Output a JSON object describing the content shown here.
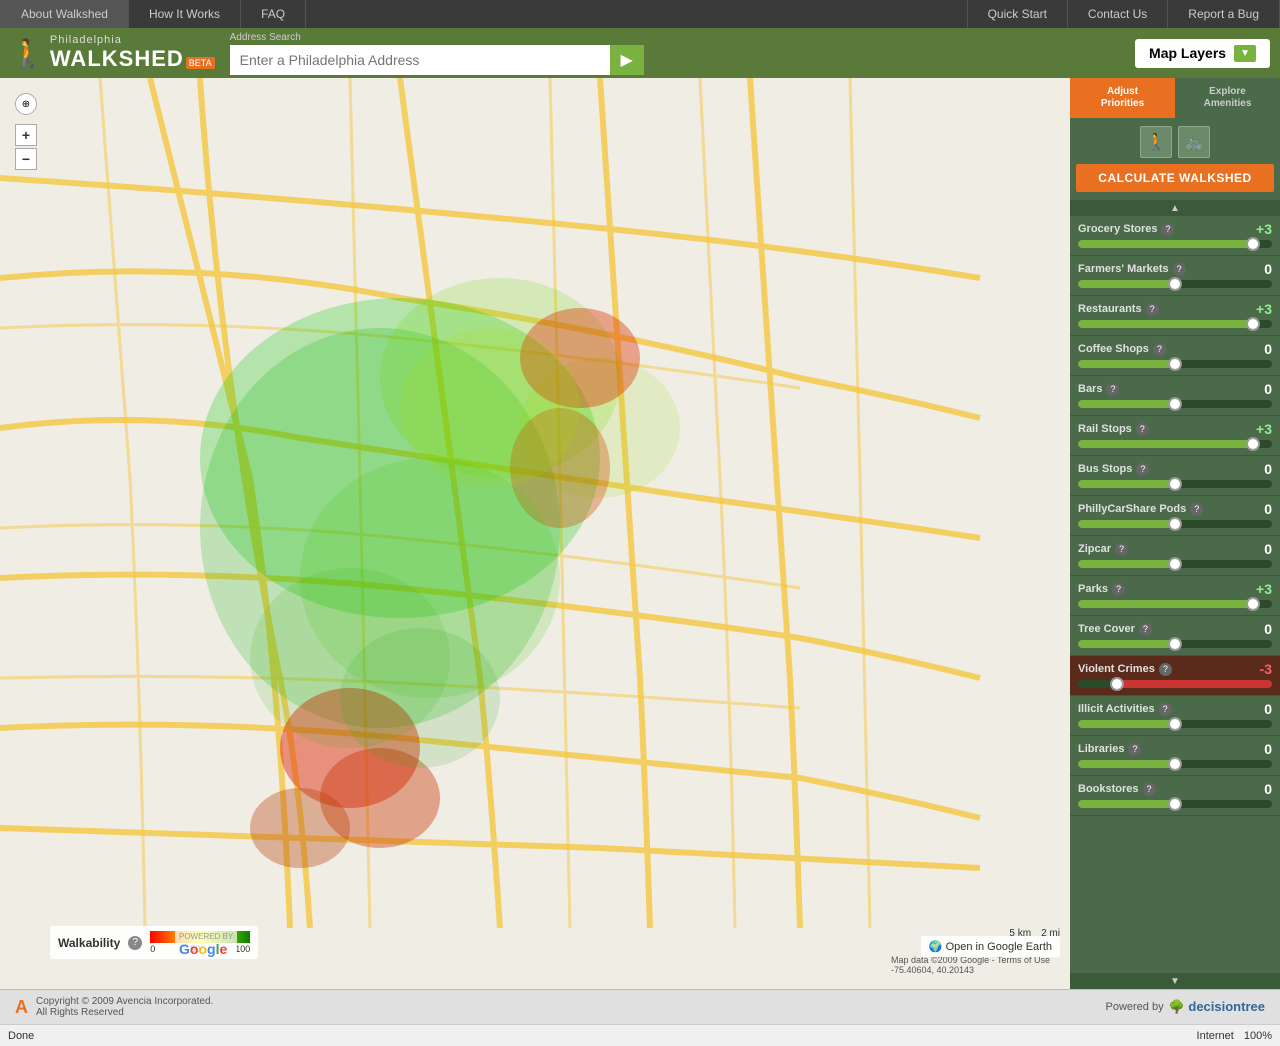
{
  "nav": {
    "left_items": [
      "About Walkshed",
      "How It Works",
      "FAQ"
    ],
    "right_items": [
      "Quick Start",
      "Contact Us",
      "Report a Bug"
    ]
  },
  "header": {
    "city": "Philadelphia",
    "app_name": "WALKSHED",
    "beta": "BETA",
    "search_label": "Address Search",
    "search_placeholder": "Enter a Philadelphia Address",
    "search_btn_icon": "▶",
    "map_layers_label": "Map Layers",
    "map_layers_arrow": "▼"
  },
  "sidebar": {
    "tab_adjust": "Adjust\nPriorities",
    "tab_explore": "Explore\nAmenities",
    "calc_btn": "CALCULATE WALKSHED",
    "sliders": [
      {
        "name": "Grocery Stores",
        "value": "+3",
        "type": "positive",
        "fill_pct": 90
      },
      {
        "name": "Farmers' Markets",
        "value": "0",
        "type": "neutral",
        "fill_pct": 50
      },
      {
        "name": "Restaurants",
        "value": "+3",
        "type": "positive",
        "fill_pct": 90
      },
      {
        "name": "Coffee Shops",
        "value": "0",
        "type": "neutral",
        "fill_pct": 50
      },
      {
        "name": "Bars",
        "value": "0",
        "type": "neutral",
        "fill_pct": 50
      },
      {
        "name": "Rail Stops",
        "value": "+3",
        "type": "positive",
        "fill_pct": 90
      },
      {
        "name": "Bus Stops",
        "value": "0",
        "type": "neutral",
        "fill_pct": 50
      },
      {
        "name": "PhillyCarShare Pods",
        "value": "0",
        "type": "neutral",
        "fill_pct": 50
      },
      {
        "name": "Zipcar",
        "value": "0",
        "type": "neutral",
        "fill_pct": 50
      },
      {
        "name": "Parks",
        "value": "+3",
        "type": "positive",
        "fill_pct": 90
      },
      {
        "name": "Tree Cover",
        "value": "0",
        "type": "neutral",
        "fill_pct": 50
      },
      {
        "name": "Violent Crimes",
        "value": "-3",
        "type": "negative",
        "fill_pct": 20
      },
      {
        "name": "Illicit Activities",
        "value": "0",
        "type": "neutral",
        "fill_pct": 50
      },
      {
        "name": "Libraries",
        "value": "0",
        "type": "neutral",
        "fill_pct": 50
      },
      {
        "name": "Bookstores",
        "value": "0",
        "type": "neutral",
        "fill_pct": 50
      }
    ]
  },
  "map": {
    "walkability_label": "Walkability",
    "open_google_earth": "Open in Google Earth",
    "google_label": "POWERED BY\nGoogle",
    "map_data_text": "Map data ©2009 Google - Terms of Use",
    "coords": "-75.40604, 40.20143",
    "scale_5km": "5 km",
    "scale_2mi": "2 mi"
  },
  "footer": {
    "logo": "A",
    "copyright": "Copyright © 2009 Avencia Incorporated.",
    "rights": "All Rights Reserved",
    "powered_by": "Powered by",
    "dt_brand": "decision",
    "dt_brand2": "tree"
  },
  "status": {
    "done": "Done",
    "zoom": "100%",
    "zone": "Internet"
  }
}
